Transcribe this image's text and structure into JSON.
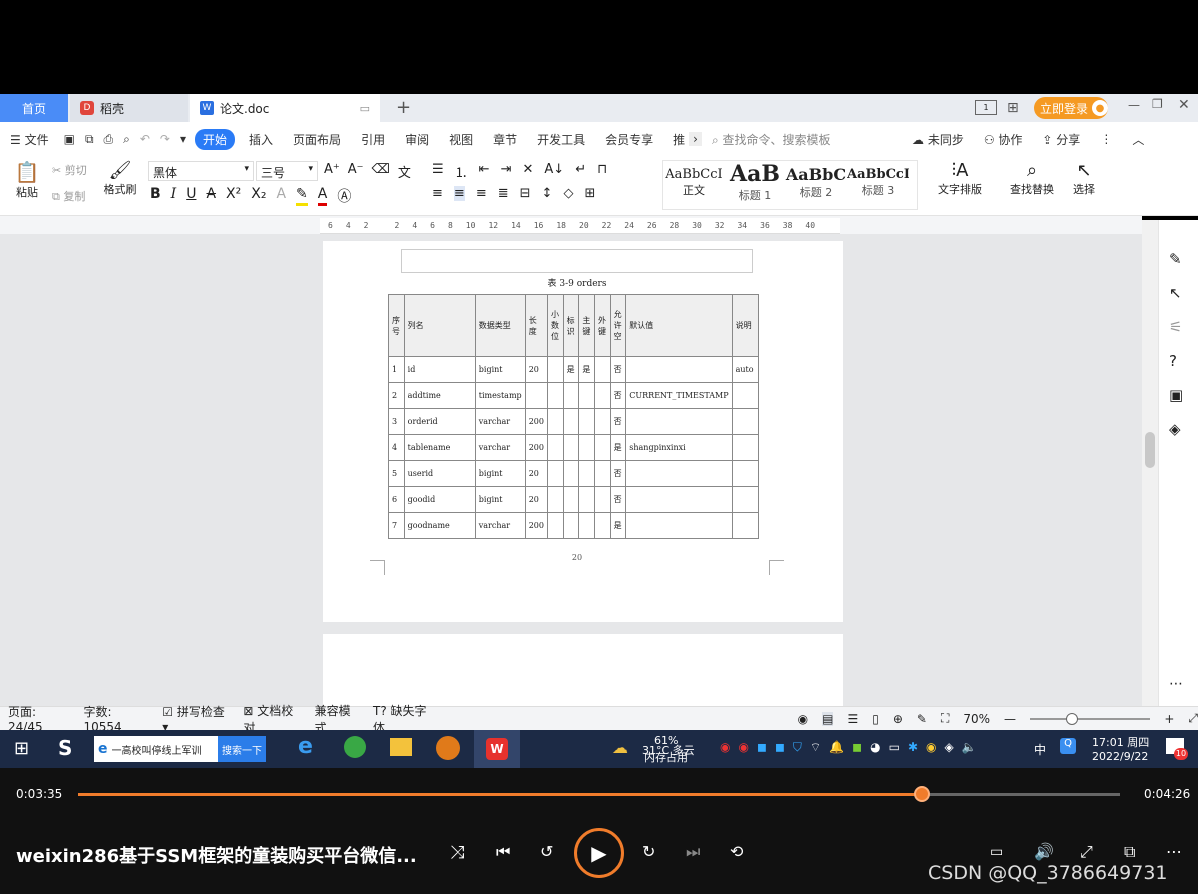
{
  "tabs": {
    "home": "首页",
    "daoke": "稻壳",
    "doc": "论文.doc",
    "new_tab": "+"
  },
  "titlebar": {
    "login": "立即登录"
  },
  "ribbon_tabs": {
    "menu": "文件",
    "items": [
      "开始",
      "插入",
      "页面布局",
      "引用",
      "审阅",
      "视图",
      "章节",
      "开发工具",
      "会员专享",
      "推"
    ],
    "search_placeholder": "查找命令、搜索模板",
    "sync": "未同步",
    "collab": "协作",
    "share": "分享"
  },
  "toolbar": {
    "paste": "粘贴",
    "cut": "剪切",
    "copy": "复制",
    "format_painter": "格式刷",
    "font_name": "黑体",
    "font_size": "三号",
    "styles": [
      {
        "preview": "AaBbCcI",
        "name": "正文"
      },
      {
        "preview": "AaB",
        "name": "标题 1"
      },
      {
        "preview": "AaBbC",
        "name": "标题 2"
      },
      {
        "preview": "AaBbCcI",
        "name": "标题 3"
      }
    ],
    "text_layout": "文字排版",
    "find_replace": "查找替换",
    "select": "选择"
  },
  "ruler": {
    "ticks": [
      "6",
      "4",
      "2",
      "",
      "2",
      "4",
      "6",
      "8",
      "10",
      "12",
      "14",
      "16",
      "18",
      "20",
      "22",
      "24",
      "26",
      "28",
      "30",
      "32",
      "34",
      "36",
      "38",
      "40"
    ]
  },
  "document": {
    "caption": "表 3-9   orders",
    "page_number": "20",
    "table": {
      "headers": [
        "序号",
        "列名",
        "数据类型",
        "长度",
        "小数位",
        "标识",
        "主键",
        "外键",
        "允许空",
        "默认值",
        "说明"
      ],
      "rows": [
        [
          "1",
          "id",
          "bigint",
          "20",
          "",
          "是",
          "是",
          "",
          "否",
          "",
          "auto"
        ],
        [
          "2",
          "addtime",
          "timestamp",
          "",
          "",
          "",
          "",
          "",
          "否",
          "CURRENT_TIMESTAMP",
          ""
        ],
        [
          "3",
          "orderid",
          "varchar",
          "200",
          "",
          "",
          "",
          "",
          "否",
          "",
          ""
        ],
        [
          "4",
          "tablename",
          "varchar",
          "200",
          "",
          "",
          "",
          "",
          "是",
          "shangpinxinxi",
          ""
        ],
        [
          "5",
          "userid",
          "bigint",
          "20",
          "",
          "",
          "",
          "",
          "否",
          "",
          ""
        ],
        [
          "6",
          "goodid",
          "bigint",
          "20",
          "",
          "",
          "",
          "",
          "否",
          "",
          ""
        ],
        [
          "7",
          "goodname",
          "varchar",
          "200",
          "",
          "",
          "",
          "",
          "是",
          "",
          ""
        ]
      ]
    }
  },
  "statusbar": {
    "page": "页面: 24/45",
    "words": "字数: 10554",
    "spell": "拼写检查",
    "proof": "文档校对",
    "compat": "兼容模式",
    "missing_font": "缺失字体",
    "zoom": "70%"
  },
  "taskbar": {
    "search_text": "一高校叫停线上军训",
    "search_btn": "搜索一下",
    "weather": "31°C 多云",
    "memory": "61%",
    "memory_label": "内存占用",
    "ime": "中",
    "time": "17:01 周四",
    "date": "2022/9/22",
    "notif": "10"
  },
  "player": {
    "elapsed": "0:03:35",
    "total": "0:04:26",
    "progress": 0.81,
    "title": "weixin286基于SSM框架的童装购买平台微信...",
    "watermark": "CSDN @QQ_3786649731"
  },
  "colors": {
    "accent": "#2a7bf6",
    "progress": "#f07c2b",
    "login": "#f59a23"
  }
}
